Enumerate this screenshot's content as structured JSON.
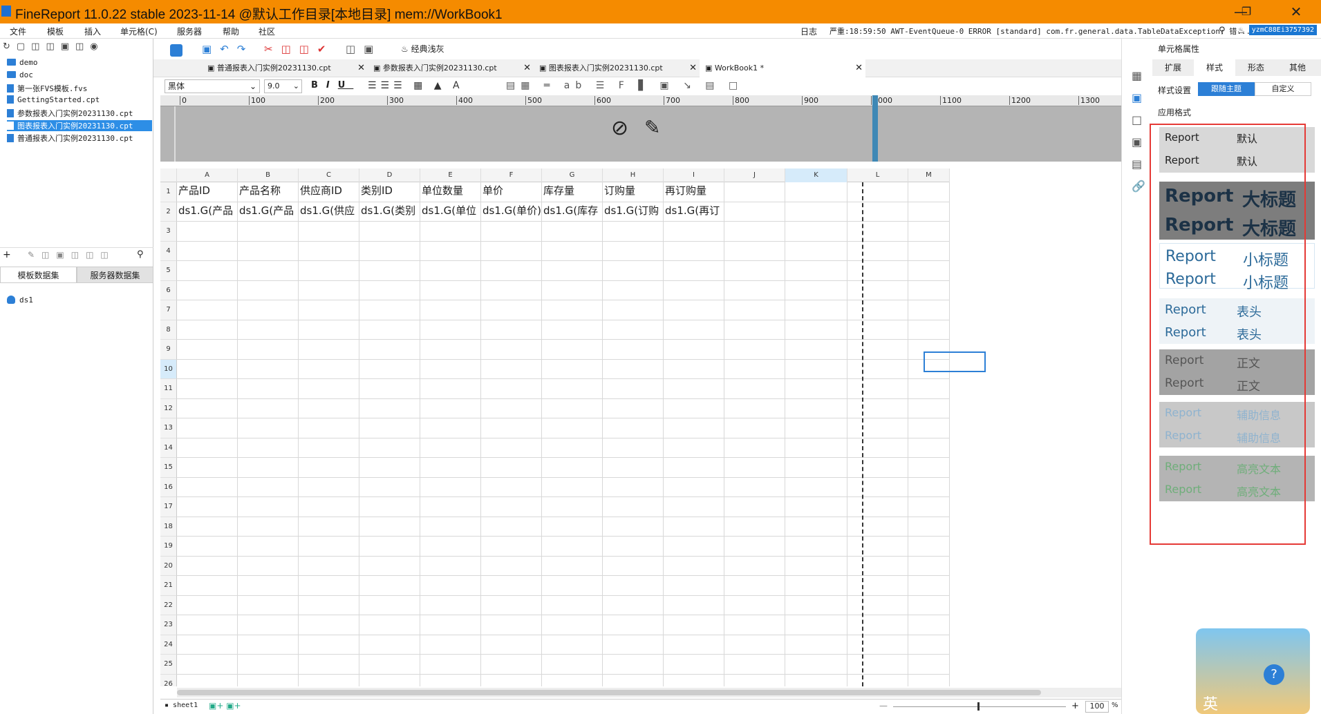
{
  "title": "FineReport 11.0.22 stable 2023-11-14 @默认工作目录[本地目录]    mem://WorkBook1",
  "menu": [
    "文件",
    "模板",
    "插入",
    "单元格(C)",
    "服务器",
    "帮助",
    "社区"
  ],
  "status": {
    "log_label": "日志",
    "message": "严重:18:59:50 AWT-EventQueue-0 ERROR [standard] com.fr.general.data.TableDataException: 错...",
    "user": "yzmC88Ei3757392"
  },
  "tree": [
    "demo",
    "doc",
    "第一张FVS模板.fvs",
    "GettingStarted.cpt",
    "参数报表入门实例20231130.cpt",
    "图表报表入门实例20231130.cpt",
    "普通报表入门实例20231130.cpt"
  ],
  "dataset_tabs": [
    "模板数据集",
    "服务器数据集"
  ],
  "dataset": "ds1",
  "toolbar": {
    "theme": "经典浅灰",
    "font": "黑体",
    "size": "9.0"
  },
  "tabs": [
    "普通报表入门实例20231130.cpt",
    "参数报表入门实例20231130.cpt",
    "图表报表入门实例20231130.cpt",
    "WorkBook1 *"
  ],
  "ruler": [
    "0",
    "100",
    "200",
    "300",
    "400",
    "500",
    "600",
    "700",
    "800",
    "900",
    "1000",
    "1100",
    "1200",
    "1300"
  ],
  "columns": [
    "A",
    "B",
    "C",
    "D",
    "E",
    "F",
    "G",
    "H",
    "I",
    "J",
    "K",
    "L",
    "M"
  ],
  "headers": [
    "产品ID",
    "产品名称",
    "供应商ID",
    "类别ID",
    "单位数量",
    "单价",
    "库存量",
    "订购量",
    "再订购量"
  ],
  "formulas": [
    "ds1.G(产品",
    "ds1.G(产品",
    "ds1.G(供应",
    "ds1.G(类别",
    "ds1.G(单位",
    "ds1.G(单价)",
    "ds1.G(库存",
    "ds1.G(订购",
    "ds1.G(再订"
  ],
  "rows": [
    "1",
    "2",
    "3",
    "4",
    "5",
    "6",
    "7",
    "8",
    "9",
    "10",
    "11",
    "12",
    "13",
    "14",
    "15",
    "16",
    "17",
    "18",
    "19",
    "20",
    "21",
    "22",
    "23",
    "24",
    "25",
    "26"
  ],
  "panel": {
    "title": "单元格属性",
    "tabs": [
      "扩展",
      "样式",
      "形态",
      "其他"
    ],
    "style_settings_label": "样式设置",
    "follow_theme": "跟随主题",
    "custom": "自定义",
    "apply_format": "应用格式",
    "styles": [
      {
        "en": "Report",
        "cn": "默认"
      },
      {
        "en": "Report",
        "cn": "大标题"
      },
      {
        "en": "Report",
        "cn": "小标题"
      },
      {
        "en": "Report",
        "cn": "表头"
      },
      {
        "en": "Report",
        "cn": "正文"
      },
      {
        "en": "Report",
        "cn": "辅助信息"
      },
      {
        "en": "Report",
        "cn": "高亮文本"
      }
    ]
  },
  "bottom": {
    "sheet": "sheet1",
    "zoom": "100",
    "zoom_unit": "%"
  },
  "assistant_label": "英"
}
